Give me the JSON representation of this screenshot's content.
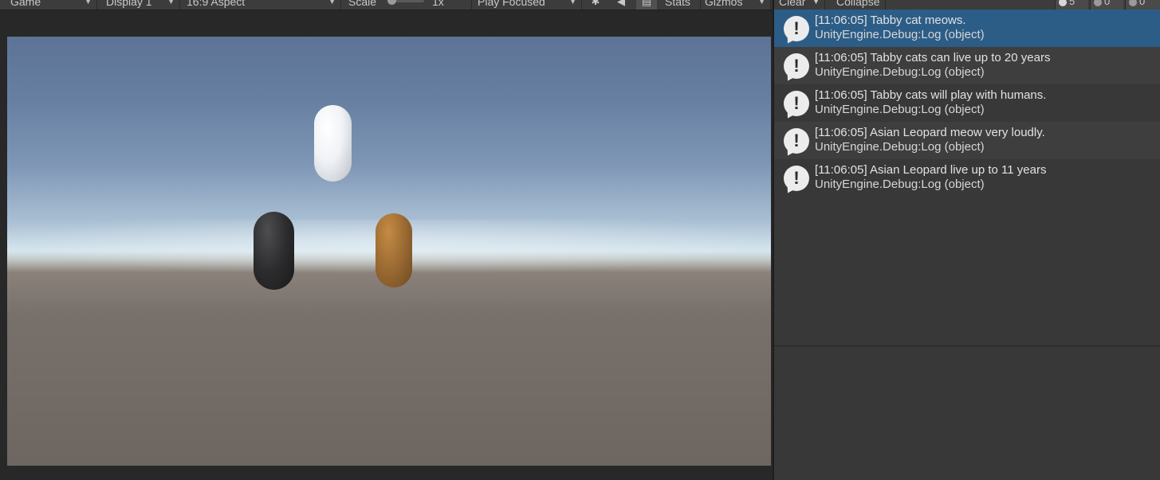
{
  "game_toolbar": {
    "view_label": "Game",
    "display_label": "Display 1",
    "aspect_label": "16:9 Aspect",
    "scale_label": "Scale",
    "scale_value": "1x",
    "scale_level": 0.0,
    "play_mode_label": "Play Focused",
    "stats_label": "Stats",
    "gizmos_label": "Gizmos"
  },
  "console_toolbar": {
    "clear_label": "Clear",
    "collapse_label": "Collapse",
    "log_count": "5",
    "warning_count": "0",
    "error_count": "0"
  },
  "console": {
    "entries": [
      {
        "message": "[11:06:05] Tabby cat meows.",
        "source": "UnityEngine.Debug:Log (object)",
        "selected": true
      },
      {
        "message": "[11:06:05] Tabby cats can live up to 20 years",
        "source": "UnityEngine.Debug:Log (object)"
      },
      {
        "message": "[11:06:05] Tabby cats will play with humans.",
        "source": "UnityEngine.Debug:Log (object)"
      },
      {
        "message": "[11:06:05] Asian Leopard meow very loudly.",
        "source": "UnityEngine.Debug:Log (object)"
      },
      {
        "message": "[11:06:05] Asian Leopard live up to 11 years",
        "source": "UnityEngine.Debug:Log (object)"
      }
    ]
  },
  "scene": {
    "objects": [
      {
        "name": "white-capsule",
        "color": "#f0f2f6"
      },
      {
        "name": "black-capsule",
        "color": "#2c2c2e"
      },
      {
        "name": "brown-capsule",
        "color": "#9a6a32"
      }
    ],
    "sky_color": "#6780a2",
    "ground_color": "#6e6661"
  },
  "colors": {
    "selection": "#2c5d87",
    "panel": "#383838",
    "toolbar": "#3c3c3c"
  }
}
